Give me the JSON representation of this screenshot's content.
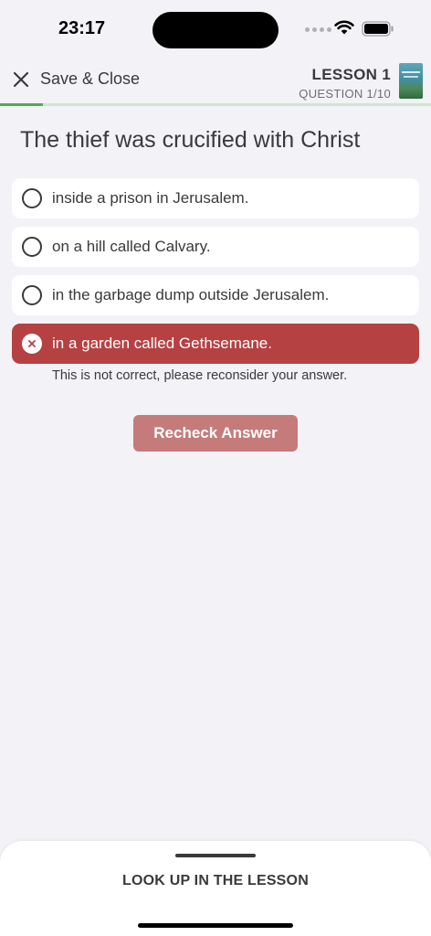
{
  "status_bar": {
    "time": "23:17"
  },
  "header": {
    "close_label": "Save & Close",
    "lesson_title": "LESSON 1",
    "question_counter": "QUESTION 1/10"
  },
  "progress": {
    "fraction": 0.1,
    "color": "#4caf50"
  },
  "question": {
    "text": "The thief was crucified with Christ",
    "options": [
      {
        "label": "inside a prison in Jerusalem.",
        "state": "unselected"
      },
      {
        "label": "on a hill called Calvary.",
        "state": "unselected"
      },
      {
        "label": "in the garbage dump outside Jerusalem.",
        "state": "unselected"
      },
      {
        "label": "in a garden called Gethsemane.",
        "state": "incorrect"
      }
    ],
    "feedback": "This is not correct, please reconsider your answer.",
    "recheck_label": "Recheck Answer"
  },
  "bottom_sheet": {
    "label": "LOOK UP IN THE LESSON"
  },
  "colors": {
    "incorrect": "#b54142",
    "recheck_button": "#c67b7b",
    "background": "#f2f2f7"
  }
}
